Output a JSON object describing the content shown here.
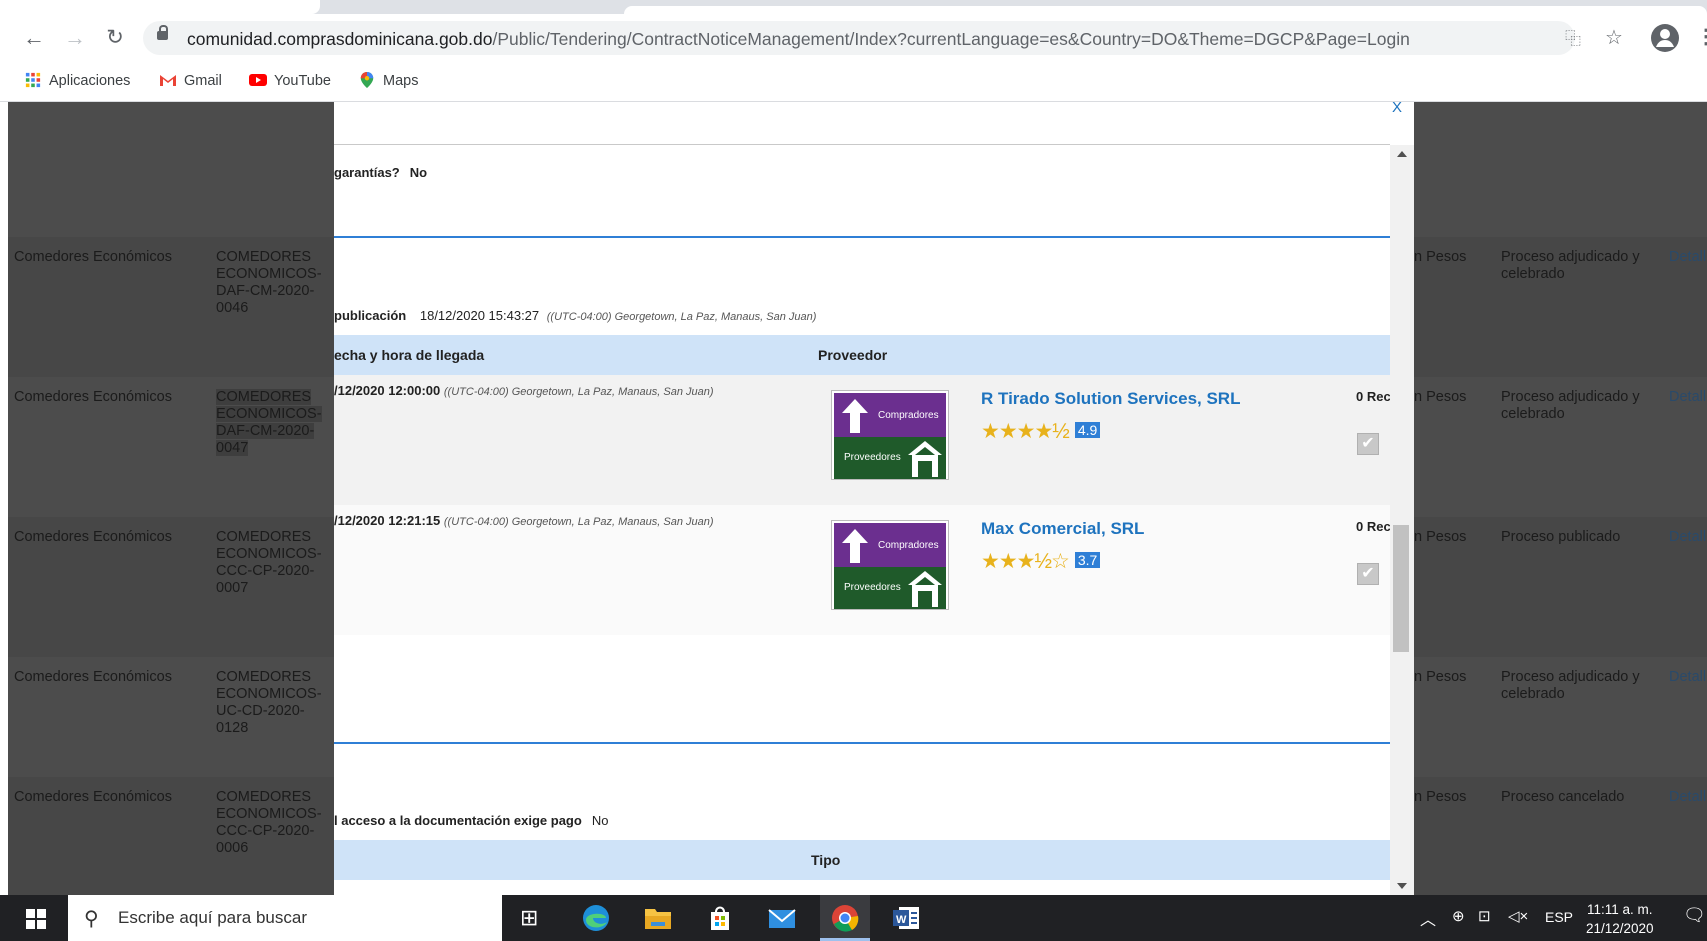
{
  "browser": {
    "url_domain": "comunidad.comprasdominicana.gob.do",
    "url_path": "/Public/Tendering/ContractNoticeManagement/Index?currentLanguage=es&Country=DO&Theme=DGCP&Page=Login",
    "bookmarks": [
      "Aplicaciones",
      "Gmail",
      "YouTube",
      "Maps"
    ]
  },
  "background_table": {
    "rows": [
      {
        "col1": "",
        "col2": "",
        "col3": "",
        "col4": "",
        "col5": ""
      },
      {
        "col1": "Comedores Económicos",
        "col2": "COMEDORES ECONOMICOS-DAF-CM-2020-0046",
        "col3": "n Pesos",
        "col4": "Proceso adjudicado y celebrado",
        "col5": "Detall"
      },
      {
        "col1": "Comedores Económicos",
        "col2": "COMEDORES ECONOMICOS-DAF-CM-2020-0047",
        "col3": "n Pesos",
        "col4": "Proceso adjudicado y celebrado",
        "col5": "Detall"
      },
      {
        "col1": "Comedores Económicos",
        "col2": "COMEDORES ECONOMICOS-CCC-CP-2020-0007",
        "col3": "n Pesos",
        "col4": "Proceso publicado",
        "col5": "Detall"
      },
      {
        "col1": "Comedores Económicos",
        "col2": "COMEDORES ECONOMICOS-UC-CD-2020-0128",
        "col3": "n Pesos",
        "col4": "Proceso adjudicado y celebrado",
        "col5": "Detall"
      },
      {
        "col1": "Comedores Económicos",
        "col2": "COMEDORES ECONOMICOS-CCC-CP-2020-0006",
        "col3": "n Pesos",
        "col4": "Proceso cancelado",
        "col5": "Detall"
      }
    ]
  },
  "modal": {
    "close": "X",
    "guarantees_q": "garantías?",
    "guarantees_v": "No",
    "publication_label": "publicación",
    "publication_date": "18/12/2020 15:43:27",
    "publication_tz": "((UTC-04:00) Georgetown, La Paz, Manaus, San Juan)",
    "col_arrival": "echa y hora de llegada",
    "col_provider": "Proveedor",
    "offers": [
      {
        "date": "/12/2020 12:00:00",
        "tz": "((UTC-04:00) Georgetown, La Paz, Manaus, San Juan)",
        "provider": "R Tirado Solution Services, SRL",
        "rating": "4.9",
        "stars": "★★★★½",
        "received": "0 Rec"
      },
      {
        "date": "/12/2020 12:21:15",
        "tz": "((UTC-04:00) Georgetown, La Paz, Manaus, San Juan)",
        "provider": "Max Comercial, SRL",
        "rating": "3.7",
        "stars": "★★★½☆",
        "received": "0 Rec"
      }
    ],
    "logo_top": "Compradores",
    "logo_bottom": "Proveedores",
    "docs_q": "l acceso a la documentación exige pago",
    "docs_v": "No",
    "col_type": "Tipo"
  },
  "taskbar": {
    "search_placeholder": "Escribe aquí para buscar",
    "lang": "ESP",
    "time": "11:11 a. m.",
    "date": "21/12/2020"
  }
}
